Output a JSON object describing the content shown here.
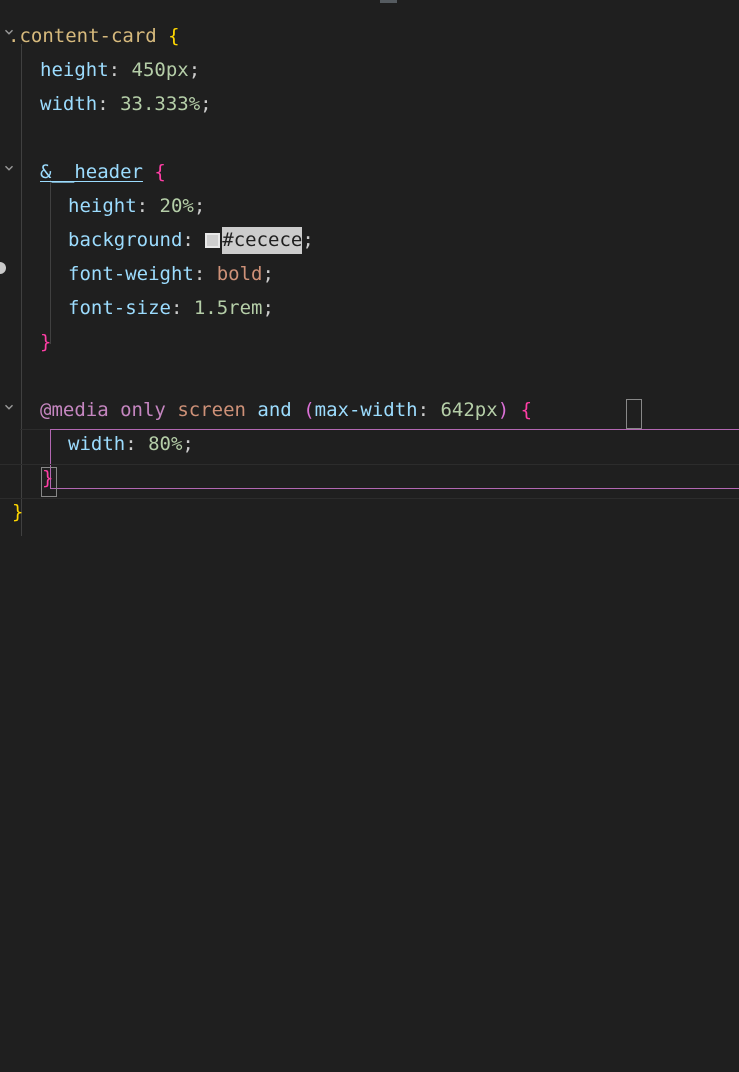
{
  "editor": {
    "language": "scss",
    "background": "#1f1f1f",
    "selection_background": "#cccccc",
    "scope_border_color": "#b267b2",
    "indent_guide_color": "#404040",
    "bracket_match_border": "#888888"
  },
  "colors": {
    "selector": "#d7ba7d",
    "brace_yellow": "#ffd700",
    "brace_pink": "#ff3ea5",
    "property": "#9cdcfe",
    "punctuation": "#cccccc",
    "number": "#b5cea8",
    "keyword_pink": "#c586c0",
    "keyword_orange": "#ce9178",
    "paren": "#da70d6"
  },
  "swatch": {
    "name": "color-swatch",
    "fill": "#cecece",
    "border": "#e8e8e8"
  },
  "gutter": {
    "fold_icon": "chevron-down-icon",
    "breakpoint_icon": "breakpoint-dot-icon"
  },
  "code": {
    "line1": {
      "selector": ".content-card",
      "space": " ",
      "brace": "{"
    },
    "line2": {
      "property": "height",
      "colon": ": ",
      "value": "450px",
      "semi": ";"
    },
    "line3": {
      "property": "width",
      "colon": ": ",
      "value": "33.333%",
      "semi": ";"
    },
    "line5": {
      "selector": "&__header",
      "space": " ",
      "brace": "{"
    },
    "line6": {
      "property": "height",
      "colon": ": ",
      "value": "20%",
      "semi": ";"
    },
    "line7": {
      "property": "background",
      "colon": ": ",
      "value": "#cecece",
      "semi": ";"
    },
    "line8": {
      "property": "font-weight",
      "colon": ": ",
      "value": "bold",
      "semi": ";"
    },
    "line9": {
      "property": "font-size",
      "colon": ": ",
      "value": "1.5rem",
      "semi": ";"
    },
    "line10": {
      "brace": "}"
    },
    "line12": {
      "at_rule": "@media",
      "sp1": " ",
      "only": "only",
      "sp2": " ",
      "media_type": "screen",
      "sp3": " ",
      "and": "and",
      "sp4": " ",
      "open_paren": "(",
      "feature": "max-width",
      "colon": ": ",
      "feature_value": "642px",
      "close_paren": ")",
      "sp5": " ",
      "brace": "{"
    },
    "line13": {
      "property": "width",
      "colon": ": ",
      "value": "80%",
      "semi": ";"
    },
    "line14": {
      "brace": "}"
    },
    "line15": {
      "brace": "}"
    }
  }
}
